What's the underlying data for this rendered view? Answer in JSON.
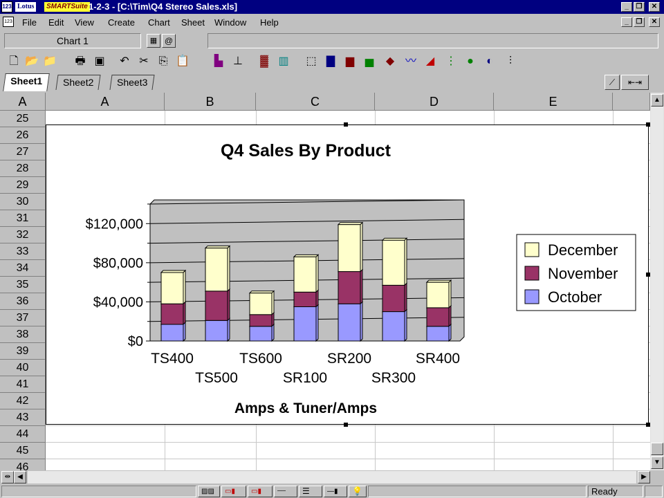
{
  "window": {
    "logo_a": "Lotus",
    "logo_b": "SMARTSuite",
    "title": "1-2-3 - [C:\\Tim\\Q4 Stereo Sales.xls]",
    "app_icon": "123"
  },
  "menu": {
    "items": [
      {
        "label": "File"
      },
      {
        "label": "Edit"
      },
      {
        "label": "View"
      },
      {
        "label": "Create"
      },
      {
        "label": "Chart"
      },
      {
        "label": "Sheet"
      },
      {
        "label": "Window"
      },
      {
        "label": "Help"
      }
    ]
  },
  "namebox": {
    "value": "Chart 1"
  },
  "tabs": [
    {
      "label": "Sheet1",
      "active": true
    },
    {
      "label": "Sheet2",
      "active": false
    },
    {
      "label": "Sheet3",
      "active": false
    }
  ],
  "grid": {
    "corner": "A",
    "columns": [
      "A",
      "B",
      "C",
      "D",
      "E"
    ],
    "rows": [
      "25",
      "26",
      "27",
      "28",
      "29",
      "30",
      "31",
      "32",
      "33",
      "34",
      "35",
      "36",
      "37",
      "38",
      "39",
      "40",
      "41",
      "42",
      "43",
      "44",
      "45",
      "46"
    ]
  },
  "chart_data": {
    "type": "bar",
    "stacked": true,
    "title": "Q4 Sales By Product",
    "xlabel": "Amps & Tuner/Amps",
    "ylabel": "",
    "categories": [
      "TS400",
      "TS500",
      "TS600",
      "SR100",
      "SR200",
      "SR300",
      "SR400"
    ],
    "series": [
      {
        "name": "October",
        "values": [
          17000,
          21000,
          15000,
          35000,
          38000,
          30000,
          15000
        ]
      },
      {
        "name": "November",
        "values": [
          21000,
          30000,
          12000,
          15000,
          33000,
          27000,
          19000
        ]
      },
      {
        "name": "December",
        "values": [
          32000,
          44000,
          22000,
          36000,
          48000,
          46000,
          26000
        ]
      }
    ],
    "legend_order": [
      "December",
      "November",
      "October"
    ],
    "colors": {
      "October": "#9999ff",
      "November": "#993366",
      "December": "#ffffcc"
    },
    "plot_background": "#c0c0c0",
    "ylim": [
      0,
      140000
    ],
    "yticks": [
      0,
      40000,
      80000,
      120000
    ],
    "ytick_labels": [
      "$0",
      "$40,000",
      "$80,000",
      "$120,000"
    ],
    "grid": true,
    "legend_position": "right"
  },
  "status": {
    "text": "Ready"
  },
  "colors": {
    "titlebar": "#000080",
    "chrome": "#c0c0c0"
  }
}
